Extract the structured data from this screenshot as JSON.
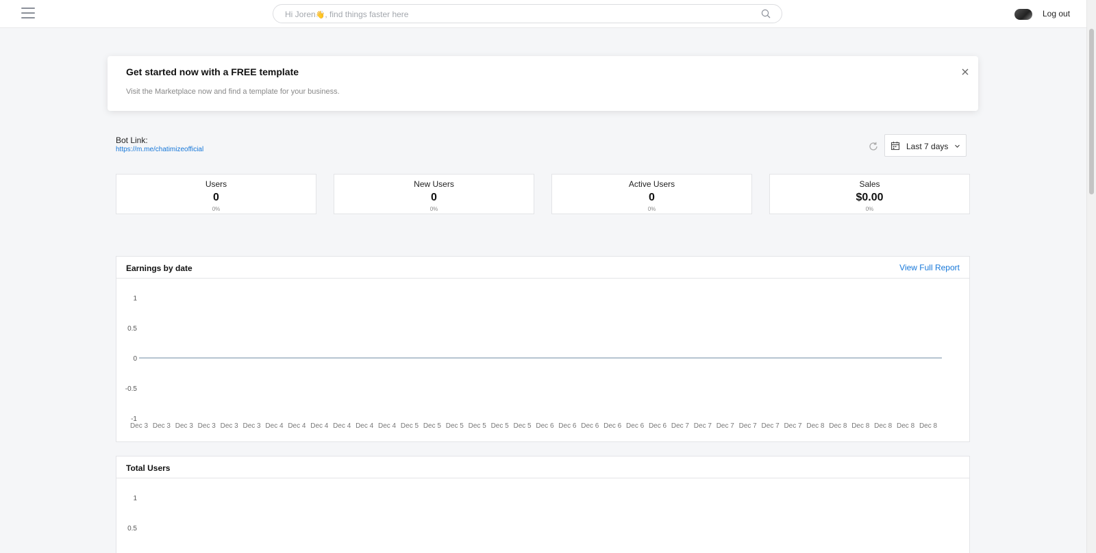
{
  "header": {
    "search_placeholder_prefix": "Hi Joren",
    "search_placeholder_emoji": "👋",
    "search_placeholder_suffix": ", find things faster here",
    "logout_label": "Log out"
  },
  "banner": {
    "title": "Get started now with a FREE template",
    "text": "Visit the Marketplace now and find a template for your business."
  },
  "bot_link": {
    "label": "Bot Link:",
    "url": "https://m.me/chatimizeofficial"
  },
  "date_range": {
    "label": "Last 7 days"
  },
  "stats": [
    {
      "label": "Users",
      "value": "0",
      "change": "0%"
    },
    {
      "label": "New Users",
      "value": "0",
      "change": "0%"
    },
    {
      "label": "Active Users",
      "value": "0",
      "change": "0%"
    },
    {
      "label": "Sales",
      "value": "$0.00",
      "change": "0%"
    }
  ],
  "earnings_panel": {
    "title": "Earnings by date",
    "link": "View Full Report"
  },
  "users_panel": {
    "title": "Total Users"
  },
  "colors": {
    "link": "#1677d9",
    "series_line": "#8aa0b4"
  },
  "chart_data": [
    {
      "type": "line",
      "title": "Earnings by date",
      "x": [
        "Dec 3",
        "Dec 3",
        "Dec 3",
        "Dec 3",
        "Dec 3",
        "Dec 3",
        "Dec 4",
        "Dec 4",
        "Dec 4",
        "Dec 4",
        "Dec 4",
        "Dec 4",
        "Dec 5",
        "Dec 5",
        "Dec 5",
        "Dec 5",
        "Dec 5",
        "Dec 5",
        "Dec 6",
        "Dec 6",
        "Dec 6",
        "Dec 6",
        "Dec 6",
        "Dec 6",
        "Dec 7",
        "Dec 7",
        "Dec 7",
        "Dec 7",
        "Dec 7",
        "Dec 7",
        "Dec 8",
        "Dec 8",
        "Dec 8",
        "Dec 8",
        "Dec 8",
        "Dec 8"
      ],
      "series": [
        {
          "values": [
            0,
            0,
            0,
            0,
            0,
            0,
            0,
            0,
            0,
            0,
            0,
            0,
            0,
            0,
            0,
            0,
            0,
            0,
            0,
            0,
            0,
            0,
            0,
            0,
            0,
            0,
            0,
            0,
            0,
            0,
            0,
            0,
            0,
            0,
            0,
            0
          ]
        }
      ],
      "yticks": [
        "1",
        "0.5",
        "0",
        "-0.5",
        "-1"
      ],
      "ylim": [
        -1,
        1
      ],
      "grid": false
    },
    {
      "type": "line",
      "title": "Total Users",
      "yticks": [
        "1",
        "0.5"
      ],
      "ylim": [
        -1,
        1
      ],
      "grid": false
    }
  ]
}
